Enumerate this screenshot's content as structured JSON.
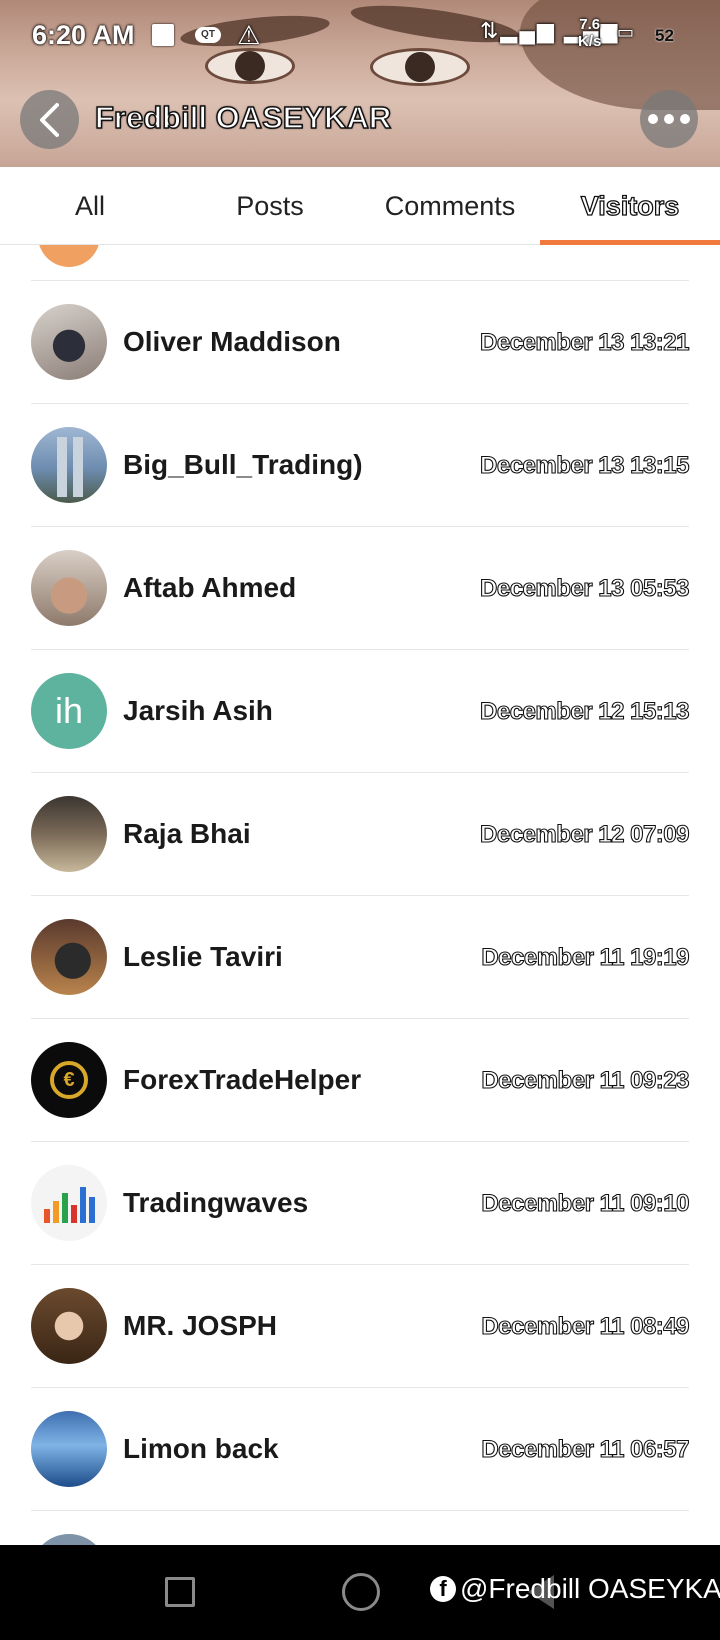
{
  "status_bar": {
    "time": "6:20 AM",
    "network": "4G",
    "speed_value": "7.6",
    "speed_unit": "K/s",
    "battery": "52"
  },
  "header": {
    "title": "Fredbill OASEYKAR",
    "back_icon": "chevron-left-icon",
    "more_icon": "more-horizontal-icon"
  },
  "tabs": [
    {
      "label": "All",
      "active": false
    },
    {
      "label": "Posts",
      "active": false
    },
    {
      "label": "Comments",
      "active": false
    },
    {
      "label": "Visitors",
      "active": true
    }
  ],
  "accent_color": "#f07a3e",
  "visitors": [
    {
      "name": "Oliver Maddison",
      "time": "December 13 13:21"
    },
    {
      "name": "Big_Bull_Trading)",
      "time": "December 13 13:15"
    },
    {
      "name": "Aftab Ahmed",
      "time": "December 13 05:53"
    },
    {
      "name": "Jarsih Asih",
      "time": "December 12 15:13",
      "initials": "ih",
      "avatar_color": "#5db39e"
    },
    {
      "name": "Raja Bhai",
      "time": "December 12 07:09"
    },
    {
      "name": "Leslie Taviri",
      "time": "December 11 19:19"
    },
    {
      "name": "ForexTradeHelper",
      "time": "December 11 09:23"
    },
    {
      "name": "Tradingwaves",
      "time": "December 11 09:10"
    },
    {
      "name": "MR. JOSPH",
      "time": "December 11 08:49"
    },
    {
      "name": "Limon back",
      "time": "December 11 06:57"
    }
  ],
  "watermark": "@Fredbill OASEYKAR"
}
